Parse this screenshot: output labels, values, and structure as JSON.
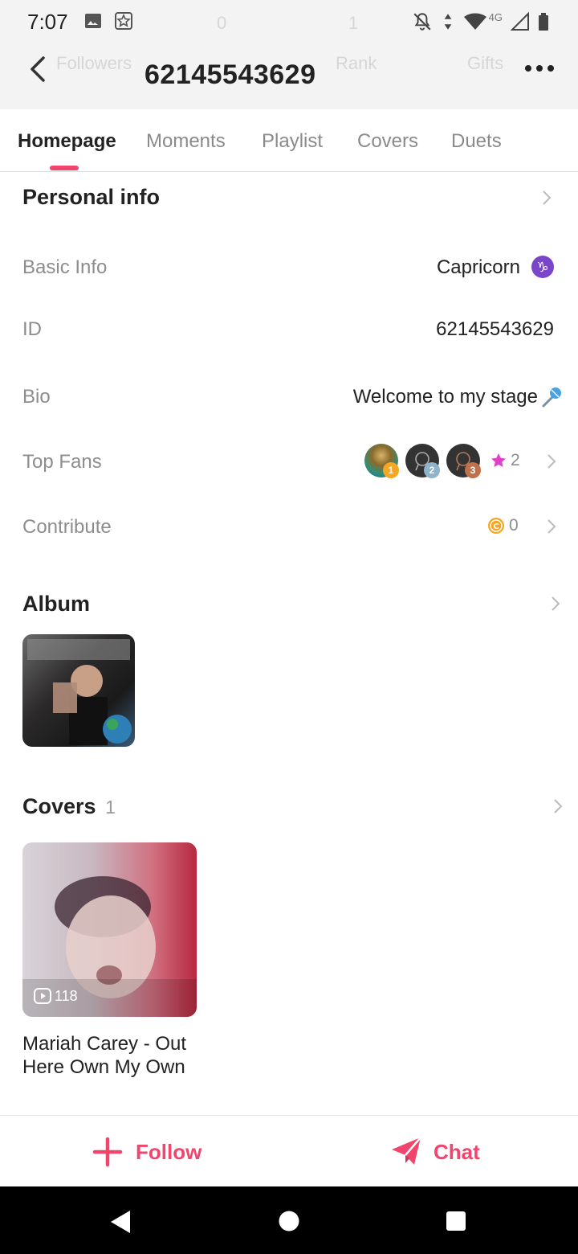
{
  "status_bar": {
    "time": "7:07",
    "network": "4G"
  },
  "header": {
    "title": "62145543629",
    "ghost_stats": [
      "Followers",
      "0",
      "1",
      "Rank",
      "Gifts"
    ]
  },
  "tabs": [
    "Homepage",
    "Moments",
    "Playlist",
    "Covers",
    "Duets"
  ],
  "personal_info": {
    "title": "Personal info",
    "rows": {
      "basic_info": {
        "label": "Basic Info",
        "value": "Capricorn"
      },
      "id": {
        "label": "ID",
        "value": "62145543629"
      },
      "bio": {
        "label": "Bio",
        "value": "Welcome to my stage"
      },
      "top_fans": {
        "label": "Top Fans",
        "count": "2",
        "ranks": [
          "1",
          "2",
          "3"
        ]
      },
      "contribute": {
        "label": "Contribute",
        "coins": "0"
      }
    }
  },
  "album": {
    "title": "Album"
  },
  "covers": {
    "title": "Covers",
    "count": "1",
    "items": [
      {
        "plays": "118",
        "title_line1": "Mariah Carey - Out",
        "title_line2": "Here Own My Own"
      }
    ]
  },
  "actions": {
    "follow": "Follow",
    "chat": "Chat"
  },
  "colors": {
    "accent": "#f2456d",
    "capricorn": "#7b45c9",
    "coin": "#f5a623",
    "star": "#e040c8"
  }
}
